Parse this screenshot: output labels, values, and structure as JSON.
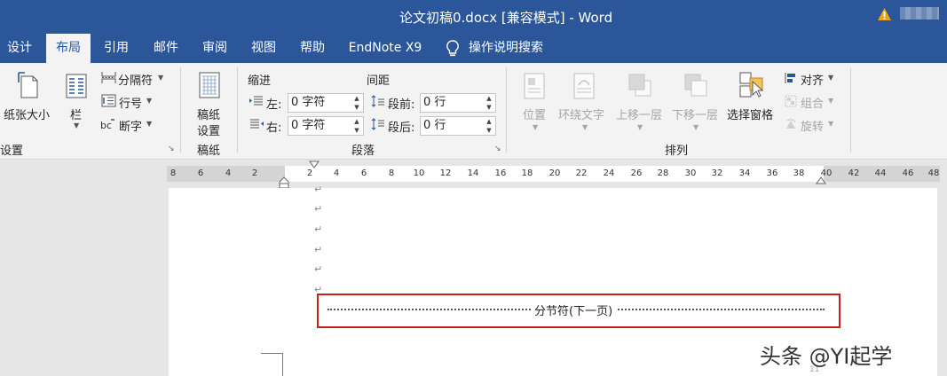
{
  "window": {
    "title": "论文初稿0.docx [兼容模式]  -  Word",
    "warning_icon": "warning-icon",
    "account_label": ""
  },
  "tabs": [
    {
      "label": "设计"
    },
    {
      "label": "布局",
      "active": true
    },
    {
      "label": "引用"
    },
    {
      "label": "邮件"
    },
    {
      "label": "审阅"
    },
    {
      "label": "视图"
    },
    {
      "label": "帮助"
    },
    {
      "label": "EndNote X9"
    },
    {
      "label": "操作说明搜索"
    }
  ],
  "ribbon": {
    "page_setup": {
      "size_label": "纸张大小",
      "columns_label": "栏",
      "breaks_label": "分隔符",
      "line_numbers_label": "行号",
      "hyphenation_label": "断字",
      "group_label": "设置"
    },
    "manuscript": {
      "button_label_1": "稿纸",
      "button_label_2": "设置",
      "group_label": "稿纸"
    },
    "paragraph": {
      "indent_title": "缩进",
      "spacing_title": "间距",
      "left_label": "左:",
      "left_value": "0 字符",
      "right_label": "右:",
      "right_value": "0 字符",
      "before_label": "段前:",
      "before_value": "0 行",
      "after_label": "段后:",
      "after_value": "0 行",
      "group_label": "段落"
    },
    "arrange": {
      "position_label": "位置",
      "wrap_label": "环绕文字",
      "forward_label": "上移一层",
      "backward_label": "下移一层",
      "selection_label": "选择窗格",
      "align_label": "对齐",
      "group_obj_label": "组合",
      "rotate_label": "旋转",
      "group_label": "排列"
    }
  },
  "ruler": {
    "left_ticks": [
      "8",
      "6",
      "4",
      "2"
    ],
    "main_ticks": [
      "2",
      "4",
      "6",
      "8",
      "10",
      "12",
      "14",
      "16",
      "18",
      "20",
      "22",
      "24",
      "26",
      "28",
      "30",
      "32",
      "34",
      "36",
      "38",
      "40"
    ],
    "right_ticks": [
      "42",
      "44",
      "46",
      "48"
    ]
  },
  "document": {
    "paragraph_mark": "↵",
    "section_break_label": "分节符(下一页)",
    "page_fragment": "11"
  },
  "watermark": "头条 @YI起学",
  "colors": {
    "title_bar": "#2b579a",
    "ribbon": "#f3f3f3",
    "highlight_box": "#c8201f",
    "warning": "#f0a30a"
  }
}
